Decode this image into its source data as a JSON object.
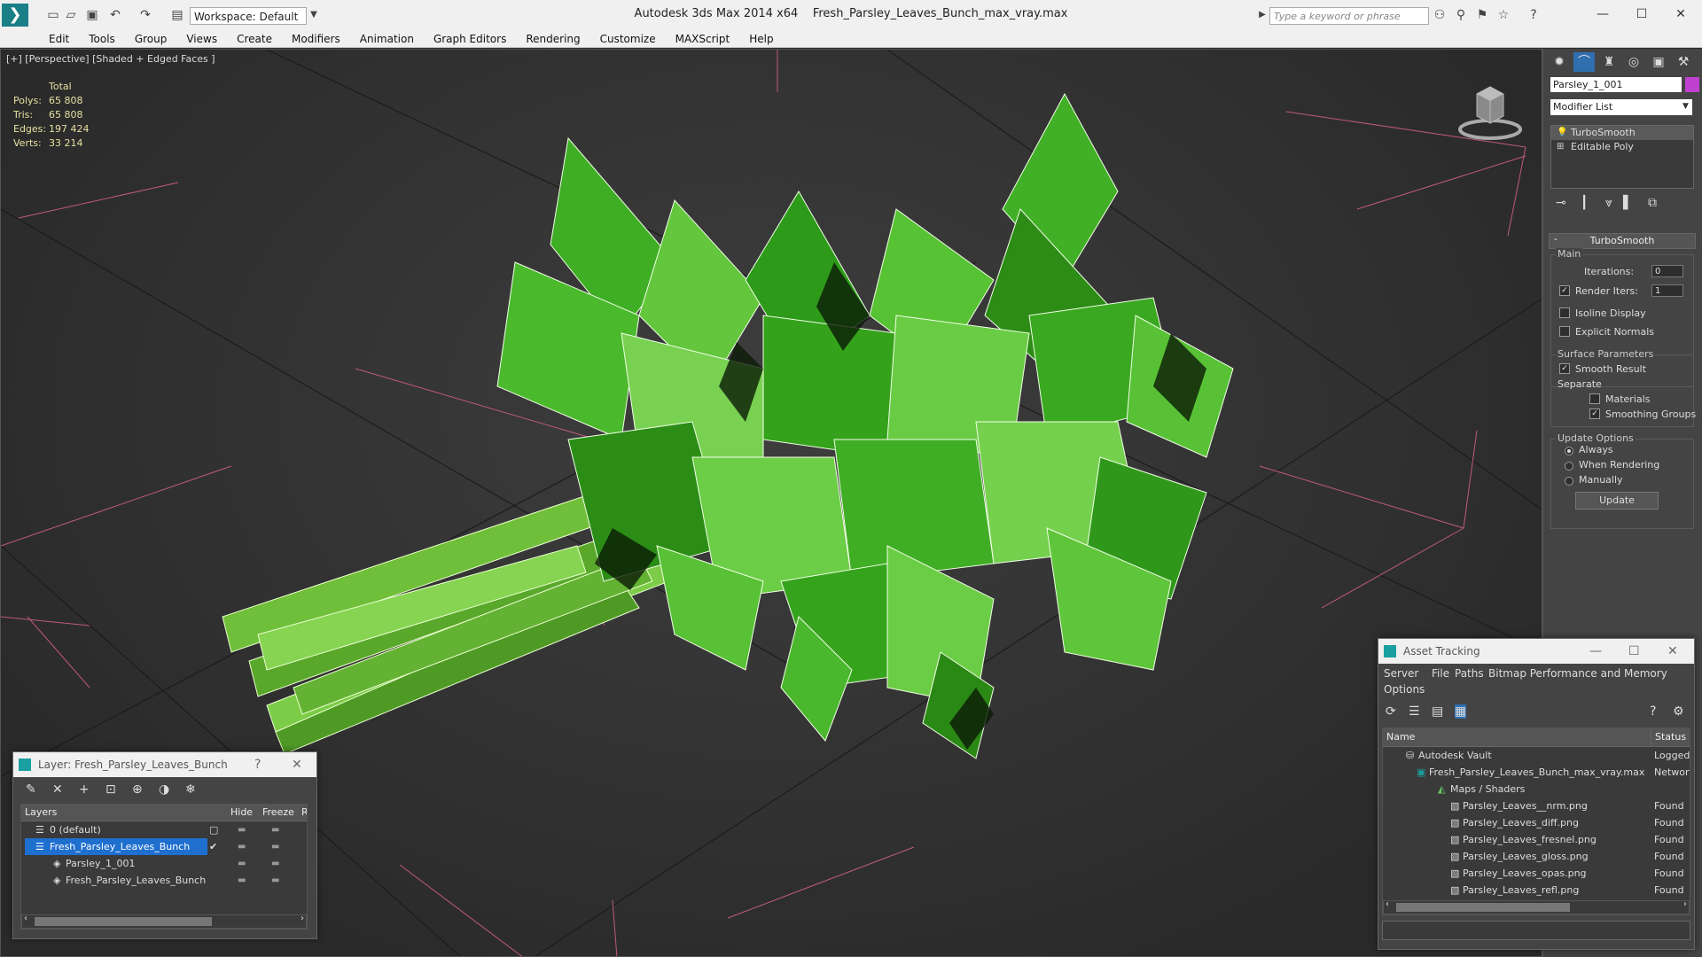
{
  "titlebar": {
    "app_title": "Autodesk 3ds Max  2014 x64",
    "file_title": "Fresh_Parsley_Leaves_Bunch_max_vray.max",
    "workspace": "Workspace: Default",
    "search_placeholder": "Type a keyword or phrase"
  },
  "menu": [
    "Edit",
    "Tools",
    "Group",
    "Views",
    "Create",
    "Modifiers",
    "Animation",
    "Graph Editors",
    "Rendering",
    "Customize",
    "MAXScript",
    "Help"
  ],
  "viewport": {
    "label": "[+] [Perspective] [Shaded + Edged Faces ]",
    "stats_header": "Total",
    "stats": [
      {
        "label": "Polys:",
        "value": "65 808"
      },
      {
        "label": "Tris:",
        "value": "65 808"
      },
      {
        "label": "Edges:",
        "value": "197 424"
      },
      {
        "label": "Verts:",
        "value": "33 214"
      }
    ]
  },
  "command_panel": {
    "object_name": "Parsley_1_001",
    "object_color": "#c040d0",
    "modifier_list": "Modifier List",
    "stack": [
      "TurboSmooth",
      "Editable Poly"
    ],
    "rollout_title": "TurboSmooth",
    "main_group": "Main",
    "iterations_label": "Iterations:",
    "iterations_value": "0",
    "render_iters_label": "Render Iters:",
    "render_iters_value": "1",
    "isoline_label": "Isoline Display",
    "explicit_normals_label": "Explicit Normals",
    "surface_group": "Surface Parameters",
    "smooth_result_label": "Smooth Result",
    "separate_label": "Separate",
    "materials_label": "Materials",
    "smoothing_groups_label": "Smoothing Groups",
    "update_group": "Update Options",
    "always_label": "Always",
    "when_rendering_label": "When Rendering",
    "manually_label": "Manually",
    "update_button": "Update"
  },
  "layer_window": {
    "title": "Layer: Fresh_Parsley_Leaves_Bunch",
    "help": "?",
    "columns": [
      "Layers",
      "Hide",
      "Freeze",
      "R"
    ],
    "rows": [
      {
        "name": "0 (default)"
      },
      {
        "name": "Fresh_Parsley_Leaves_Bunch"
      },
      {
        "name": "Parsley_1_001"
      },
      {
        "name": "Fresh_Parsley_Leaves_Bunch"
      }
    ]
  },
  "asset_window": {
    "title": "Asset Tracking",
    "menu": [
      "Server",
      "File",
      "Paths",
      "Bitmap Performance and Memory"
    ],
    "menu2": "Options",
    "columns": [
      "Name",
      "Status"
    ],
    "rows": [
      {
        "name": "Autodesk Vault",
        "status": "Logged"
      },
      {
        "name": "Fresh_Parsley_Leaves_Bunch_max_vray.max",
        "status": "Networ"
      },
      {
        "name": "Maps / Shaders",
        "status": ""
      },
      {
        "name": "Parsley_Leaves__nrm.png",
        "status": "Found"
      },
      {
        "name": "Parsley_Leaves_diff.png",
        "status": "Found"
      },
      {
        "name": "Parsley_Leaves_fresnel.png",
        "status": "Found"
      },
      {
        "name": "Parsley_Leaves_gloss.png",
        "status": "Found"
      },
      {
        "name": "Parsley_Leaves_opas.png",
        "status": "Found"
      },
      {
        "name": "Parsley_Leaves_refl.png",
        "status": "Found"
      }
    ]
  }
}
